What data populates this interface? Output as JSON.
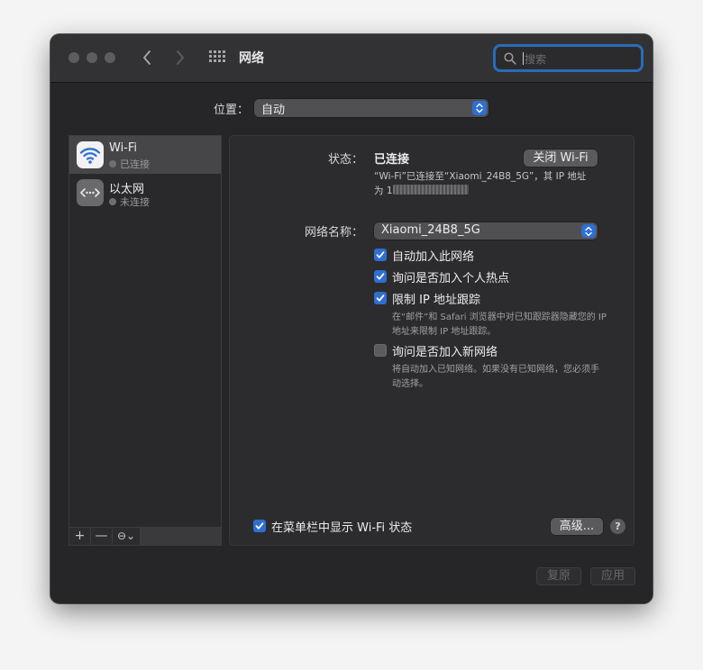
{
  "window": {
    "title": "网络"
  },
  "search": {
    "placeholder": "搜索"
  },
  "location": {
    "label": "位置：",
    "value": "自动"
  },
  "sidebar": {
    "items": [
      {
        "name": "Wi-Fi",
        "status": "已连接",
        "icon": "wifi-icon",
        "selected": true
      },
      {
        "name": "以太网",
        "status": "未连接",
        "icon": "ethernet-icon",
        "selected": false
      }
    ],
    "add_label": "+",
    "remove_label": "—",
    "action_label": "⊖⌄"
  },
  "detail": {
    "status_label": "状态：",
    "status_value": "已连接",
    "toggle_wifi_button": "关闭 Wi-Fi",
    "status_desc_line1": "“Wi-Fi”已连接至“Xiaomi_24B8_5G”，其 IP 地址",
    "status_desc_line2": "为 1",
    "network_name_label": "网络名称：",
    "network_name_value": "Xiaomi_24B8_5G",
    "options": [
      {
        "label": "自动加入此网络",
        "checked": true
      },
      {
        "label": "询问是否加入个人热点",
        "checked": true
      },
      {
        "label": "限制 IP 地址跟踪",
        "checked": true,
        "desc_line1": "在“邮件”和 Safari 浏览器中对已知跟踪器隐藏您的 IP",
        "desc_line2": "地址来限制 IP 地址跟踪。"
      },
      {
        "label": "询问是否加入新网络",
        "checked": false,
        "desc_line1": "将自动加入已知网络。如果没有已知网络，您必须手",
        "desc_line2": "动选择。"
      }
    ],
    "show_in_menubar_label": "在菜单栏中显示 Wi-Fi 状态",
    "show_in_menubar_checked": true,
    "advanced_button": "高级...",
    "help_label": "?"
  },
  "footer": {
    "revert_button": "复原",
    "apply_button": "应用"
  },
  "colors": {
    "accent": "#2e6fd0",
    "wifi_icon_bg": "#f2f2f4",
    "wifi_icon_fg": "#2e6fd0",
    "ethernet_icon_bg": "#6a6a6d"
  }
}
